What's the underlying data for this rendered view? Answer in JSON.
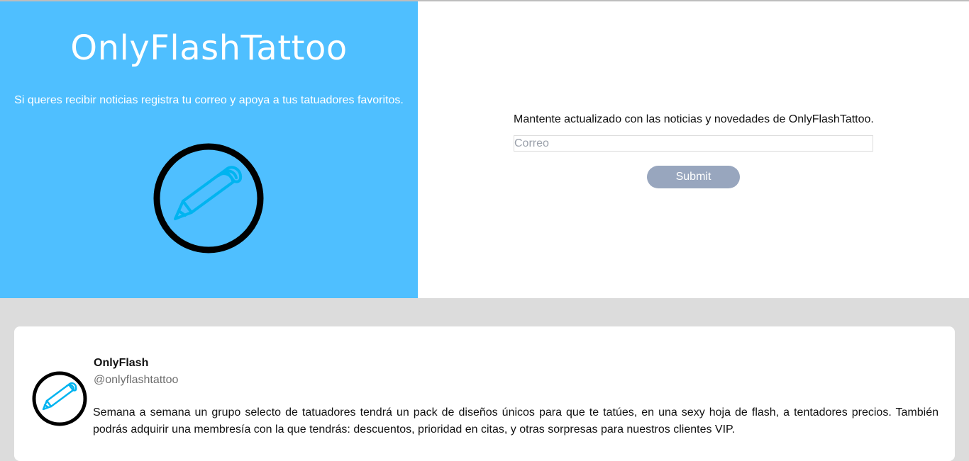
{
  "hero": {
    "title": "OnlyFlashTattoo",
    "subtitle": "Si queres recibir noticias registra tu correo y apoya a tus tatuadores favoritos.",
    "logo_icon": "pencil-in-circle-icon",
    "background_color": "#4fbfff"
  },
  "newsletter": {
    "text": "Mantente actualizado con las noticias y novedades de OnlyFlashTattoo.",
    "email_placeholder": "Correo",
    "email_value": "",
    "submit_label": "Submit",
    "submit_color": "#98a6be"
  },
  "post": {
    "avatar_icon": "pencil-in-circle-icon",
    "name": "OnlyFlash",
    "handle": "@onlyflashtattoo",
    "body": "Semana a semana un grupo selecto de tatuadores tendrá un pack de diseños únicos para que te tatúes, en una sexy hoja de flash, a tentadores precios. También podrás adquirir una membresía con la que tendrás: descuentos, prioridad en citas, y otras sorpresas para nuestros clientes VIP."
  }
}
